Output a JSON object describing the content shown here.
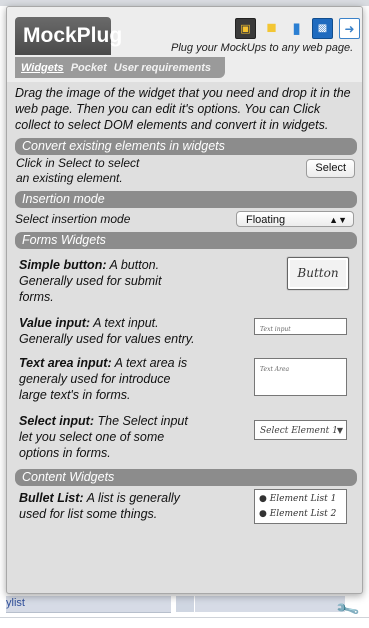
{
  "background": {
    "link_text": "ylist"
  },
  "header": {
    "logo": "MockPlug",
    "tagline": "Plug your MockUps to any web page."
  },
  "toolbar": {
    "icons": [
      "image-icon",
      "note-icon",
      "trash-icon",
      "save-icon",
      "export-icon"
    ]
  },
  "tabs": [
    {
      "label": "Widgets",
      "active": true
    },
    {
      "label": "Pocket",
      "active": false
    },
    {
      "label": "User requirements",
      "active": false
    }
  ],
  "intro": "Drag the image of the widget that you need and drop it in the web page. Then you can edit it's options. You can Click collect to select DOM elements and convert it in widgets.",
  "convert": {
    "heading": "Convert existing elements in widgets",
    "text_line1": "Click in Select to select",
    "text_line2": "an existing element.",
    "button": "Select"
  },
  "insertion": {
    "heading": "Insertion mode",
    "label": "Select insertion mode",
    "value": "Floating"
  },
  "forms": {
    "heading": "Forms Widgets",
    "simple_button": {
      "title": "Simple button:",
      "desc_line1": " A button.",
      "desc_line2": "Generally used for submit",
      "desc_line3": "forms.",
      "preview": "Button"
    },
    "value_input": {
      "title": "Value input:",
      "desc_line1": " A text input.",
      "desc_line2": "Generally used for values entry.",
      "preview": "Text input"
    },
    "text_area": {
      "title": "Text area input:",
      "desc_line1": " A text area is",
      "desc_line2": "generaly used for introduce",
      "desc_line3": "large text's in forms.",
      "preview": "Text Area"
    },
    "select_input": {
      "title": "Select input:",
      "desc_line1": " The Select input",
      "desc_line2": "let you select one of some",
      "desc_line3": "options in forms.",
      "preview": "Select Element 1"
    }
  },
  "content_widgets": {
    "heading": "Content Widgets",
    "bullet_list": {
      "title": "Bullet List:",
      "desc_line1": " A list is generally",
      "desc_line2": "used for list some things.",
      "preview": [
        "Element List 1",
        "Element List 2"
      ]
    }
  }
}
